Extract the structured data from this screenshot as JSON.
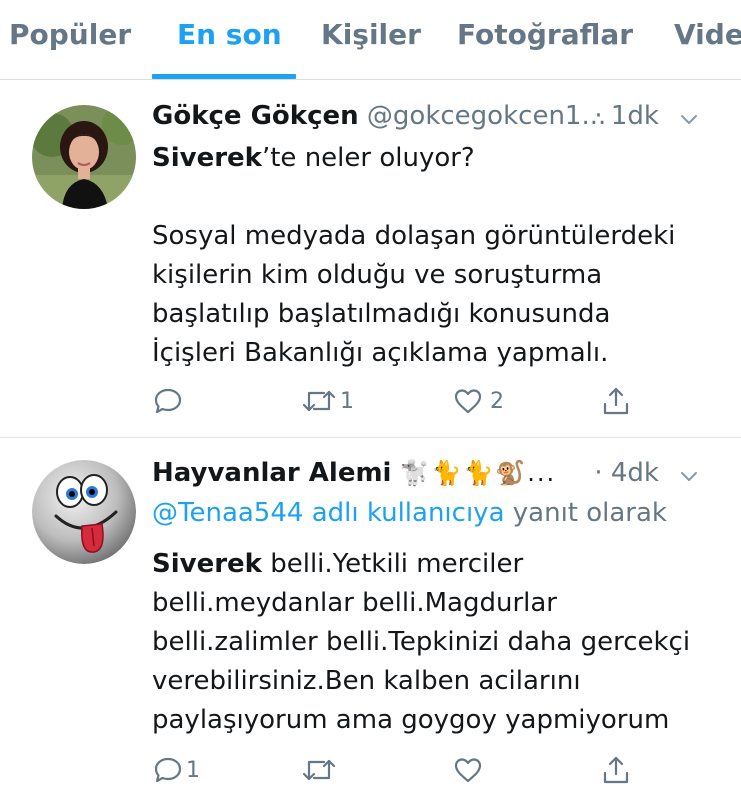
{
  "tabs": [
    {
      "label": "Popüler"
    },
    {
      "label": "En son"
    },
    {
      "label": "Kişiler"
    },
    {
      "label": "Fotoğraflar"
    },
    {
      "label": "Video"
    }
  ],
  "active_tab": "En son",
  "accent_color": "#1da1f2",
  "tweets": [
    {
      "name": "Gökçe Gökçen",
      "handle": "@gokcegokcen1...",
      "time": "· 1dk",
      "text_bold": "Siverek",
      "text_rest": "’te neler oluyor?",
      "text_body": "Sosyal medyada dolaşan görüntülerdeki\nkişilerin kim olduğu ve soruşturma\nbaşlatılıp başlatılmadığı konusunda\nİçişleri Bakanlığı açıklama yapmalı.",
      "reply_count": "",
      "retweet_count": "1",
      "like_count": "2"
    },
    {
      "name": "Hayvanlar Alemi",
      "name_emoji": "🐩🐈🐈🐒...",
      "time": "· 4dk",
      "reply_to_link": "@Tenaa544 adlı kullanıcıya",
      "reply_to_rest": " yanıt olarak",
      "text_bold": "Siverek",
      "text_rest": " belli.Yetkili merciler\nbelli.meydanlar belli.Magdurlar\nbelli.zalimler belli.Tepkinizi daha gercekçi\nverebilirsiniz.Ben kalben acilarını\npaylaşıyorum ama goygoy yapmiyorum",
      "reply_count": "1",
      "retweet_count": "",
      "like_count": ""
    }
  ],
  "icons": [
    "reply-icon",
    "retweet-icon",
    "like-icon",
    "share-icon",
    "chevron-down-icon"
  ]
}
